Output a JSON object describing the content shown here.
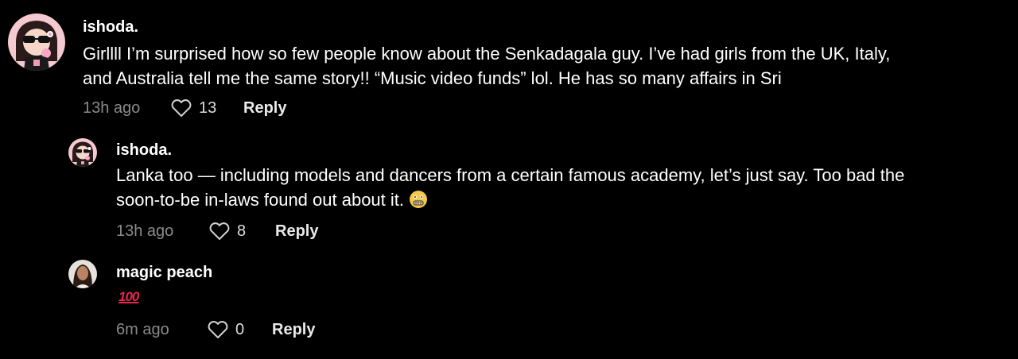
{
  "comments": [
    {
      "username": "ishoda.",
      "text_line1": "Girllll I’m surprised how so few people know about the Senkadagala guy. I’ve had girls from the UK, Italy,",
      "text_line2": "and Australia tell me the same story!! “Music video funds” lol. He has so many affairs in Sri",
      "time": "13h ago",
      "likes": "13",
      "reply_label": "Reply",
      "avatar_icon": "cartoon-girl-avatar"
    },
    {
      "username": "ishoda.",
      "text_line1": "Lanka too — including models and dancers from a certain famous academy, let’s just say. Too bad the",
      "text_line2": "soon-to-be in-laws found out about it.",
      "emoji": "grimacing-face-emoji",
      "time": "13h ago",
      "likes": "8",
      "reply_label": "Reply",
      "avatar_icon": "cartoon-girl-avatar"
    },
    {
      "username": "magic peach",
      "text": "💯",
      "time": "6m ago",
      "likes": "0",
      "reply_label": "Reply",
      "avatar_icon": "photo-avatar"
    }
  ],
  "colors": {
    "background": "#000000",
    "meta_gray": "#8a8a8a",
    "hundred_red": "#e5294b"
  }
}
